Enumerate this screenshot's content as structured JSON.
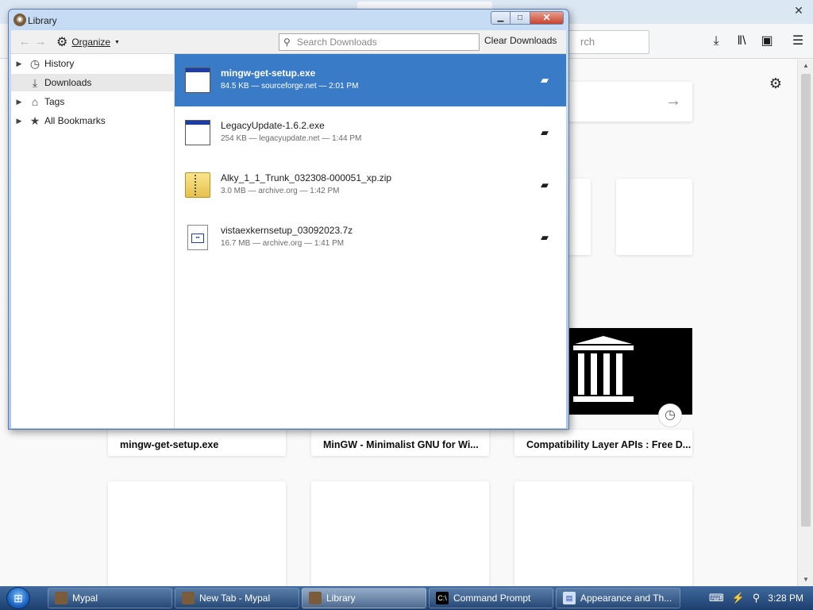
{
  "background_browser": {
    "search_placeholder_visible": "rch",
    "highlights": [
      {
        "title": "mingw-get-setup.exe"
      },
      {
        "title": "MinGW - Minimalist GNU for Wi..."
      },
      {
        "title": "Compatibility Layer APIs : Free D..."
      }
    ]
  },
  "library": {
    "title": "Library",
    "toolbar": {
      "organize_label": "Organize",
      "search_placeholder": "Search Downloads",
      "clear_label": "Clear Downloads"
    },
    "sidebar": [
      {
        "label": "History",
        "icon": "clock-icon",
        "expandable": true
      },
      {
        "label": "Downloads",
        "icon": "download-icon",
        "expandable": false,
        "selected": true
      },
      {
        "label": "Tags",
        "icon": "tag-icon",
        "expandable": true
      },
      {
        "label": "All Bookmarks",
        "icon": "star-icon",
        "expandable": true
      }
    ],
    "downloads": [
      {
        "name": "mingw-get-setup.exe",
        "meta": "84.5 KB — sourceforge.net — 2:01 PM",
        "icon": "exe-file-icon",
        "selected": true
      },
      {
        "name": "LegacyUpdate-1.6.2.exe",
        "meta": "254 KB — legacyupdate.net — 1:44 PM",
        "icon": "exe-file-icon"
      },
      {
        "name": "Alky_1_1_Trunk_032308-000051_xp.zip",
        "meta": "3.0 MB — archive.org — 1:42 PM",
        "icon": "zip-file-icon"
      },
      {
        "name": "vistaexkernsetup_03092023.7z",
        "meta": "16.7 MB — archive.org — 1:41 PM",
        "icon": "7z-file-icon"
      }
    ]
  },
  "taskbar": {
    "buttons": [
      {
        "label": "Mypal"
      },
      {
        "label": "New Tab - Mypal"
      },
      {
        "label": "Library",
        "active": true
      },
      {
        "label": "Command Prompt"
      },
      {
        "label": "Appearance and Th..."
      }
    ],
    "clock": "3:28 PM"
  },
  "colors": {
    "selection": "#3a7bc8",
    "taskbar": "#1d3f6e"
  }
}
